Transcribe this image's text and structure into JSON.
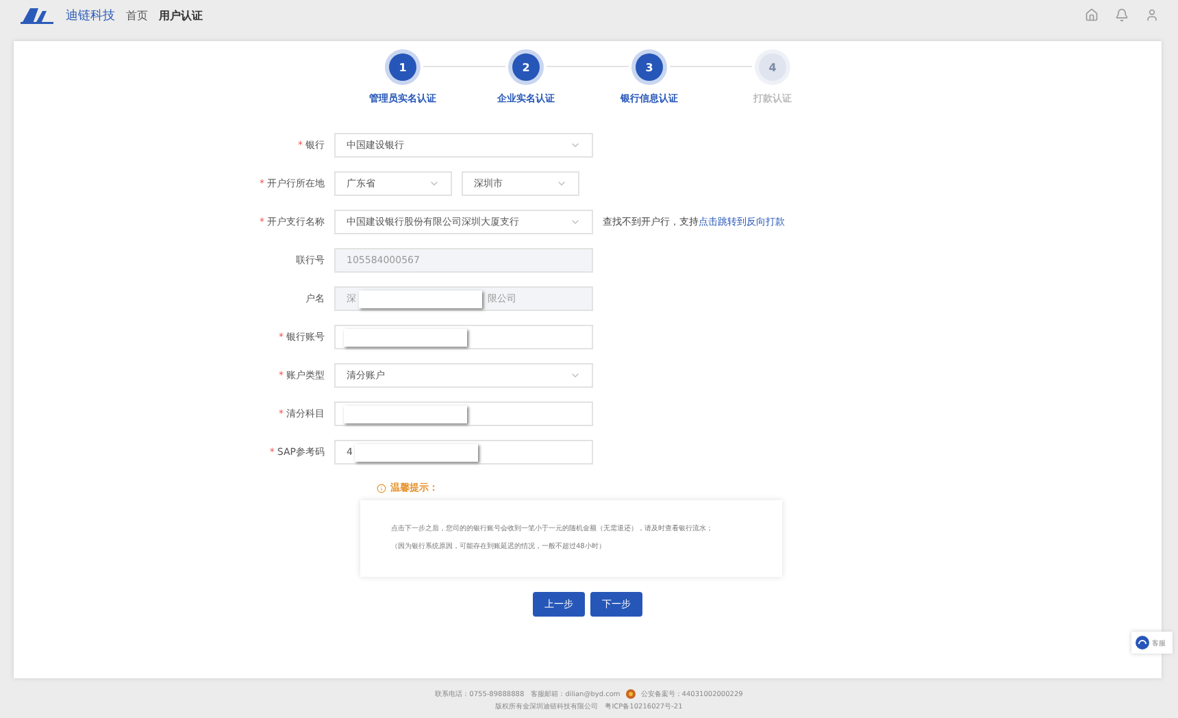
{
  "header": {
    "brand": "迪链科技",
    "nav": [
      {
        "label": "首页",
        "selected": false
      },
      {
        "label": "用户认证",
        "selected": true
      }
    ]
  },
  "steps": [
    {
      "number": "1",
      "label": "管理员实名认证",
      "completed": true
    },
    {
      "number": "2",
      "label": "企业实名认证",
      "completed": true
    },
    {
      "number": "3",
      "label": "银行信息认证",
      "completed": true
    },
    {
      "number": "4",
      "label": "打款认证",
      "completed": false
    }
  ],
  "form": [
    {
      "label": "银行",
      "required": true,
      "controls": [
        {
          "kind": "select",
          "value": "中国建设银行",
          "redacted": false
        }
      ]
    },
    {
      "label": "开户行所在地",
      "required": true,
      "controls": [
        {
          "kind": "select-half",
          "value": "广东省",
          "redacted": false
        },
        {
          "kind": "select-half",
          "value": "深圳市",
          "redacted": false
        }
      ]
    },
    {
      "label": "开户支行名称",
      "required": true,
      "controls": [
        {
          "kind": "select",
          "value": "中国建设银行股份有限公司深圳大厦支行",
          "redacted": false
        }
      ],
      "hint": "查找不到开户行，支持",
      "hint_link": "点击跳转到反向打款"
    },
    {
      "label": "联行号",
      "required": false,
      "controls": [
        {
          "kind": "readonly",
          "value": "105584000567",
          "redacted": false
        }
      ]
    },
    {
      "label": "户名",
      "required": false,
      "controls": [
        {
          "kind": "readonly",
          "value": "深",
          "value_after": "限公司",
          "redacted": true
        }
      ]
    },
    {
      "label": "银行账号",
      "required": true,
      "controls": [
        {
          "kind": "input",
          "redacted": true
        }
      ]
    },
    {
      "label": "账户类型",
      "required": true,
      "controls": [
        {
          "kind": "select",
          "value": "清分账户",
          "redacted": false
        }
      ]
    },
    {
      "label": "清分科目",
      "required": true,
      "controls": [
        {
          "kind": "input",
          "redacted": true
        }
      ]
    },
    {
      "label": "SAP参考码",
      "required": true,
      "controls": [
        {
          "kind": "input",
          "value": "4",
          "redacted": true
        }
      ]
    }
  ],
  "notice": {
    "title": "温馨提示：",
    "lines": [
      "点击下一步之后，您司的的银行账号会收到一笔小于一元的随机金额（无需退还），请及时查看银行流水；",
      "（因为银行系统原因，可能存在到账延迟的情况，一般不超过48小时）"
    ]
  },
  "buttons": [
    "上一步",
    "下一步"
  ],
  "required_mark": "*",
  "help": {
    "label": "客服"
  },
  "footer": {
    "contact": "联系电话：0755-89888888　客服邮箱：dilian@byd.com",
    "record": "公安备案号：44031002000229",
    "copyright": "版权所有金深圳迪链科技有限公司　粤ICP备10216027号-21"
  }
}
